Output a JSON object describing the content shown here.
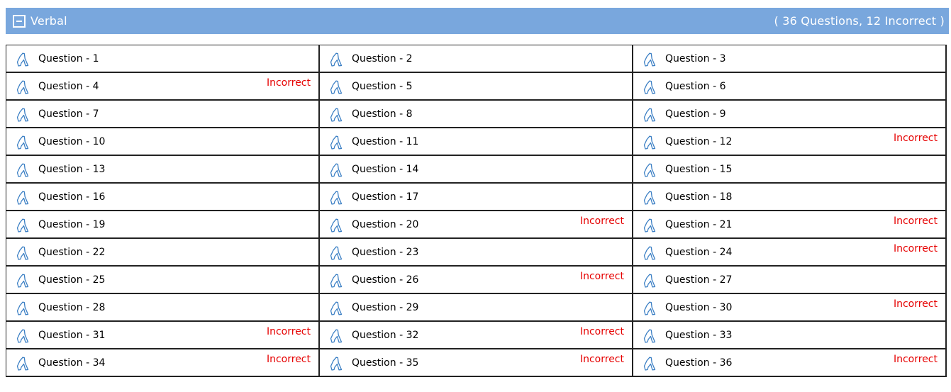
{
  "section": {
    "title": "Verbal",
    "summary": "( 36 Questions, 12 Incorrect )"
  },
  "questions": [
    {
      "label": "Question - 1",
      "status": ""
    },
    {
      "label": "Question - 2",
      "status": ""
    },
    {
      "label": "Question - 3",
      "status": ""
    },
    {
      "label": "Question - 4",
      "status": "Incorrect"
    },
    {
      "label": "Question - 5",
      "status": ""
    },
    {
      "label": "Question - 6",
      "status": ""
    },
    {
      "label": "Question - 7",
      "status": ""
    },
    {
      "label": "Question - 8",
      "status": ""
    },
    {
      "label": "Question - 9",
      "status": ""
    },
    {
      "label": "Question - 10",
      "status": ""
    },
    {
      "label": "Question - 11",
      "status": ""
    },
    {
      "label": "Question - 12",
      "status": "Incorrect"
    },
    {
      "label": "Question - 13",
      "status": ""
    },
    {
      "label": "Question - 14",
      "status": ""
    },
    {
      "label": "Question - 15",
      "status": ""
    },
    {
      "label": "Question - 16",
      "status": ""
    },
    {
      "label": "Question - 17",
      "status": ""
    },
    {
      "label": "Question - 18",
      "status": ""
    },
    {
      "label": "Question - 19",
      "status": ""
    },
    {
      "label": "Question - 20",
      "status": "Incorrect"
    },
    {
      "label": "Question - 21",
      "status": "Incorrect"
    },
    {
      "label": "Question - 22",
      "status": ""
    },
    {
      "label": "Question - 23",
      "status": ""
    },
    {
      "label": "Question - 24",
      "status": "Incorrect"
    },
    {
      "label": "Question - 25",
      "status": ""
    },
    {
      "label": "Question - 26",
      "status": "Incorrect"
    },
    {
      "label": "Question - 27",
      "status": ""
    },
    {
      "label": "Question - 28",
      "status": ""
    },
    {
      "label": "Question - 29",
      "status": ""
    },
    {
      "label": "Question - 30",
      "status": "Incorrect"
    },
    {
      "label": "Question - 31",
      "status": "Incorrect"
    },
    {
      "label": "Question - 32",
      "status": "Incorrect"
    },
    {
      "label": "Question - 33",
      "status": ""
    },
    {
      "label": "Question - 34",
      "status": "Incorrect"
    },
    {
      "label": "Question - 35",
      "status": "Incorrect"
    },
    {
      "label": "Question - 36",
      "status": "Incorrect"
    }
  ],
  "colors": {
    "header_bg": "#79a7dd",
    "incorrect": "#e60000",
    "icon_stroke": "#3b7fc4"
  },
  "icons": {
    "question": "hand-pointer-icon",
    "collapse": "collapse-minus-icon"
  }
}
